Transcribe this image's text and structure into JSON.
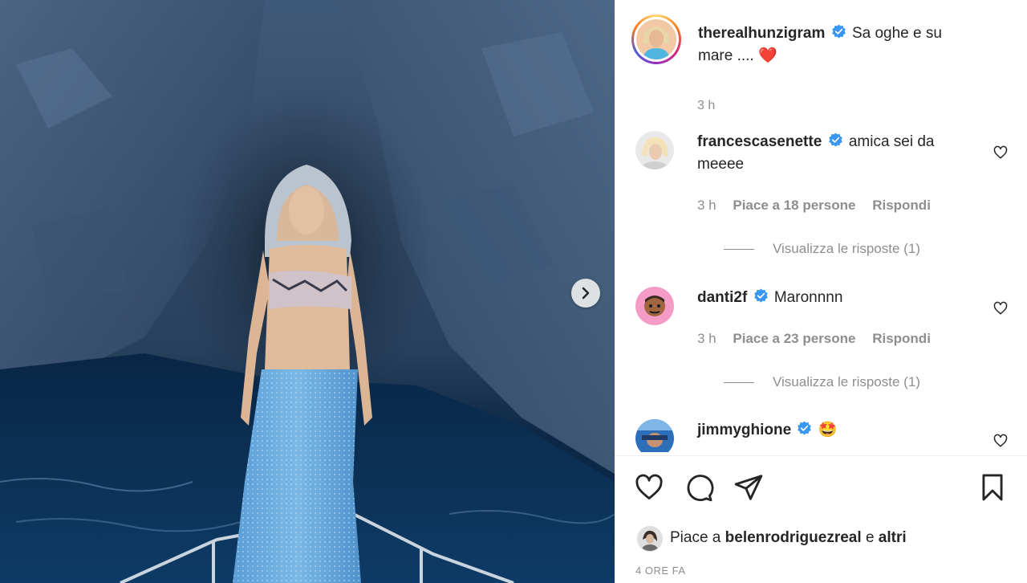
{
  "post": {
    "username": "therealhunzigram",
    "caption": "Sa oghe e su mare ....",
    "caption_emoji": "❤️",
    "time": "3 h",
    "verified": true
  },
  "comments": [
    {
      "username": "francescasenette",
      "verified": true,
      "text": "amica sei da meeee",
      "time": "3 h",
      "likes": "Piace a 18 persone",
      "reply": "Rispondi",
      "view_replies": "Visualizza le risposte (1)"
    },
    {
      "username": "danti2f",
      "verified": true,
      "text": "Maronnnn",
      "time": "3 h",
      "likes": "Piace a 23 persone",
      "reply": "Rispondi",
      "view_replies": "Visualizza le risposte (1)"
    },
    {
      "username": "jimmyghione",
      "verified": true,
      "text": "🤩"
    }
  ],
  "likes": {
    "prefix": "Piace a",
    "user": "belenrodriguezreal",
    "conjunction": "e",
    "others": "altri"
  },
  "post_time": "4 ORE FA",
  "icons": {
    "like": "heart-icon",
    "comment": "comment-icon",
    "share": "share-icon",
    "save": "bookmark-icon",
    "next": "chevron-right-icon",
    "verified": "verified-badge-icon"
  },
  "colors": {
    "verified": "#3897f0",
    "text": "#262626",
    "muted": "#8e8e8e",
    "heart": "#ed4956"
  }
}
